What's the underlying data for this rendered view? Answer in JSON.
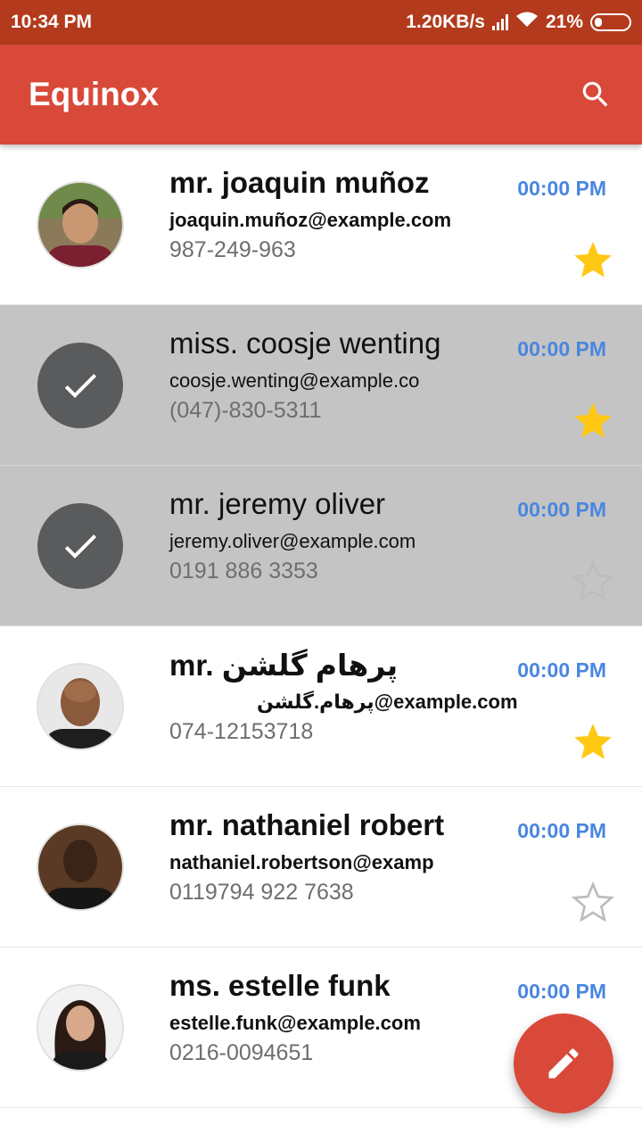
{
  "status_bar": {
    "time": "10:34 PM",
    "speed": "1.20KB/s",
    "battery": "21%"
  },
  "app_bar": {
    "title": "Equinox",
    "search_icon": "search-icon"
  },
  "contacts": [
    {
      "name": "mr. joaquin muñoz",
      "email": "joaquin.muñoz@example.com",
      "phone": "987-249-963",
      "time": "00:00 PM",
      "starred": true,
      "selected": false,
      "unread": true
    },
    {
      "name": "miss. coosje wenting",
      "email": "coosje.wenting@example.co",
      "phone": "(047)-830-5311",
      "time": "00:00 PM",
      "starred": true,
      "selected": true,
      "unread": false
    },
    {
      "name": "mr. jeremy oliver",
      "email": "jeremy.oliver@example.com",
      "phone": "0191 886 3353",
      "time": "00:00 PM",
      "starred": false,
      "selected": true,
      "unread": false
    },
    {
      "name": "mr. پرهام گلشن",
      "email": "پرهام.گلشن@example.com",
      "phone": "074-12153718",
      "time": "00:00 PM",
      "starred": true,
      "selected": false,
      "unread": true
    },
    {
      "name": "mr. nathaniel robert",
      "email": "nathaniel.robertson@examp",
      "phone": "0119794 922 7638",
      "time": "00:00 PM",
      "starred": false,
      "selected": false,
      "unread": true
    },
    {
      "name": "ms. estelle funk",
      "email": "estelle.funk@example.com",
      "phone": "0216-0094651",
      "time": "00:00 PM",
      "starred": false,
      "selected": false,
      "unread": true
    }
  ],
  "fab": {
    "icon": "pencil-icon"
  },
  "colors": {
    "status_bar": "#b33a1c",
    "app_bar": "#d9493a",
    "time": "#4a86e0",
    "star": "#ffc815",
    "selected_row": "#c4c4c4"
  }
}
